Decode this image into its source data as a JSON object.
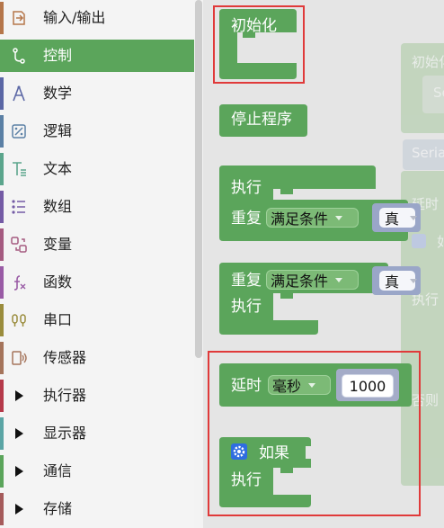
{
  "sidebar": {
    "items": [
      {
        "label": "输入/输出",
        "icon": "input-output-icon",
        "color": "#b5764a",
        "expandable": false
      },
      {
        "label": "控制",
        "icon": "control-flow-icon",
        "color": "#5ba55b",
        "expandable": false,
        "selected": true
      },
      {
        "label": "数学",
        "icon": "math-compass-icon",
        "color": "#5b67a5",
        "expandable": false
      },
      {
        "label": "逻辑",
        "icon": "logic-icon",
        "color": "#5b80a5",
        "expandable": false
      },
      {
        "label": "文本",
        "icon": "text-icon",
        "color": "#5ba58c",
        "expandable": false
      },
      {
        "label": "数组",
        "icon": "list-icon",
        "color": "#745ba5",
        "expandable": false
      },
      {
        "label": "变量",
        "icon": "variable-icon",
        "color": "#a55b80",
        "expandable": false
      },
      {
        "label": "函数",
        "icon": "function-icon",
        "color": "#995ba5",
        "expandable": false
      },
      {
        "label": "串口",
        "icon": "serial-port-icon",
        "color": "#9a8c3c",
        "expandable": false
      },
      {
        "label": "传感器",
        "icon": "sensor-icon",
        "color": "#a5745b",
        "expandable": false
      },
      {
        "label": "执行器",
        "icon": "expand-arrow-icon",
        "color": "#b53a4a",
        "expandable": true
      },
      {
        "label": "显示器",
        "icon": "expand-arrow-icon",
        "color": "#5ba5a5",
        "expandable": true
      },
      {
        "label": "通信",
        "icon": "expand-arrow-icon",
        "color": "#5ba55b",
        "expandable": true
      },
      {
        "label": "存储",
        "icon": "expand-arrow-icon",
        "color": "#a55b5b",
        "expandable": true
      }
    ]
  },
  "flyout": {
    "init_label": "初始化",
    "stop_label": "停止程序",
    "do_while": {
      "do_label": "执行",
      "repeat_label": "重复",
      "condition_option": "满足条件",
      "bool_value": "真"
    },
    "while_do": {
      "repeat_label": "重复",
      "condition_option": "满足条件",
      "bool_value": "真",
      "do_label": "执行"
    },
    "delay": {
      "label": "延时",
      "unit_option": "毫秒",
      "value": "1000"
    },
    "if_block": {
      "if_label": "如果",
      "do_label": "执行"
    }
  },
  "workspace_ghost": {
    "init_label": "初始化",
    "serial_label": "Seria",
    "serial_label_2": "Seria",
    "delay_label": "延时",
    "if_label": "如",
    "do_label": "执行",
    "else_label": "否则"
  },
  "colors": {
    "block_green": "#5ba55b",
    "selected_green": "#5ba55b",
    "highlight_red": "#e03a3a",
    "bool_blue": "#9aa6c8"
  }
}
